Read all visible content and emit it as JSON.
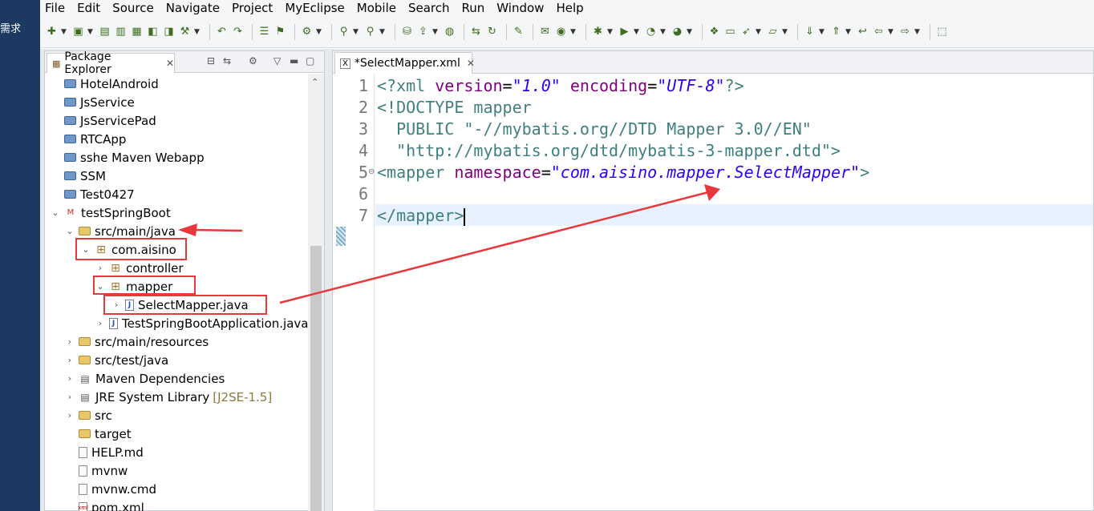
{
  "desktop": {
    "text_line1": "需求",
    "text_line2": ""
  },
  "menubar": [
    "File",
    "Edit",
    "Source",
    "Navigate",
    "Project",
    "MyEclipse",
    "Mobile",
    "Search",
    "Run",
    "Window",
    "Help"
  ],
  "explorer": {
    "title": "Package Explorer",
    "rows": [
      {
        "label": "HotelAndroid",
        "icon": "project-icon"
      },
      {
        "label": "JsService",
        "icon": "project-icon"
      },
      {
        "label": "JsServicePad",
        "icon": "project-icon"
      },
      {
        "label": "RTCApp",
        "icon": "project-icon"
      },
      {
        "label": "sshe Maven Webapp",
        "icon": "project-icon"
      },
      {
        "label": "SSM",
        "icon": "project-icon"
      },
      {
        "label": "Test0427",
        "icon": "project-icon"
      },
      {
        "label": "testSpringBoot",
        "icon": "maven-project-icon"
      },
      {
        "label": "src/main/java",
        "icon": "source-folder-icon"
      },
      {
        "label": "com.aisino",
        "icon": "package-icon"
      },
      {
        "label": "controller",
        "icon": "package-icon"
      },
      {
        "label": "mapper",
        "icon": "package-icon"
      },
      {
        "label": "SelectMapper.java",
        "icon": "java-file-icon"
      },
      {
        "label": "TestSpringBootApplication.java",
        "icon": "java-file-icon"
      },
      {
        "label": "src/main/resources",
        "icon": "source-folder-icon"
      },
      {
        "label": "src/test/java",
        "icon": "source-folder-icon"
      },
      {
        "label": "Maven Dependencies",
        "icon": "library-icon"
      },
      {
        "label": "JRE System Library",
        "icon": "library-icon",
        "suffix": "[J2SE-1.5]"
      },
      {
        "label": "src",
        "icon": "folder-icon"
      },
      {
        "label": "target",
        "icon": "folder-icon"
      },
      {
        "label": "HELP.md",
        "icon": "file-icon"
      },
      {
        "label": "mvnw",
        "icon": "file-icon"
      },
      {
        "label": "mvnw.cmd",
        "icon": "file-icon"
      },
      {
        "label": "pom.xml",
        "icon": "xml-file-icon"
      }
    ]
  },
  "editor": {
    "tab_title": "*SelectMapper.xml",
    "line_numbers": [
      "1",
      "2",
      "3",
      "4",
      "5",
      "6",
      "7"
    ],
    "lines": {
      "l1": {
        "a": "<?xml ",
        "b": "version",
        "c": "=",
        "d": "\"1.0\"",
        "e": " ",
        "f": "encoding",
        "g": "=",
        "h": "\"UTF-8\"",
        "i": "?>"
      },
      "l2": "<!DOCTYPE mapper",
      "l3": "  PUBLIC \"-//mybatis.org//DTD Mapper 3.0//EN\"",
      "l4": "  \"http://mybatis.org/dtd/mybatis-3-mapper.dtd\">",
      "l5": {
        "a": "<mapper ",
        "b": "namespace",
        "c": "=",
        "d": "\"com.aisino.mapper.SelectMapper\"",
        "e": ">"
      },
      "l6": "",
      "l7": "</mapper>"
    }
  },
  "colors": {
    "annotation": "#e8383c",
    "current_line": "#e8f2fe"
  }
}
